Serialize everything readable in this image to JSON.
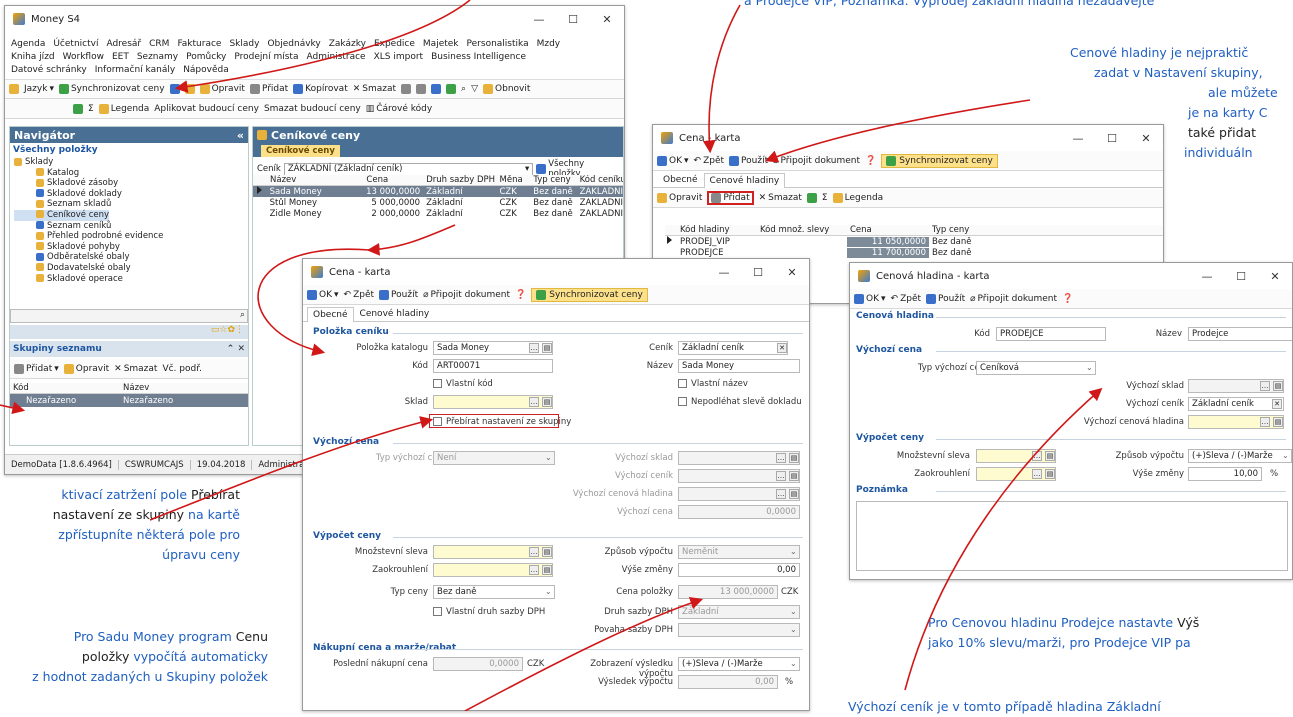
{
  "win1": {
    "title": "Money S4",
    "menu_row1": [
      "Agenda",
      "Účetnictví",
      "Adresář",
      "CRM",
      "Fakturace",
      "Sklady",
      "Objednávky",
      "Zakázky",
      "Expedice",
      "Majetek",
      "Personalistika",
      "Mzdy"
    ],
    "menu_row2": [
      "Kniha jízd",
      "Workflow",
      "EET",
      "Seznamy",
      "Pomůcky",
      "Prodejní místa",
      "Administrace",
      "XLS import",
      "Business Intelligence"
    ],
    "menu_row3": [
      "Datové schránky",
      "Informační kanály",
      "Nápověda"
    ],
    "toolbar1": [
      "Jazyk",
      "Synchronizovat ceny",
      "Opravit",
      "Přidat",
      "Kopírovat",
      "Smazat",
      "Obnovit"
    ],
    "toolbar2": [
      "Legenda",
      "Aplikovat budoucí ceny",
      "Smazat budoucí ceny",
      "Čárové kódy"
    ],
    "nav_title": "Navigátor",
    "nav_sub": "Všechny položky",
    "tree": [
      "Sklady",
      "Katalog",
      "Skladové zásoby",
      "Skladové doklady",
      "Seznam skladů",
      "Ceníkové ceny",
      "Seznam ceníků",
      "Přehled podrobné evidence",
      "Skladové pohyby",
      "Odběratelské obaly",
      "Dodavatelské obaly",
      "Skladové operace"
    ],
    "groups_title": "Skupiny seznamu",
    "groups_tb": [
      "Přidat",
      "Opravit",
      "Smazat",
      "Vč. podř."
    ],
    "groups_cols": [
      "Kód",
      "Název"
    ],
    "groups_row": [
      "Nezařazeno",
      "Nezařazeno"
    ],
    "main_title": "Ceníkové ceny",
    "main_tab": "Ceníkové ceny",
    "filter_label": "Ceník",
    "filter_value": "ZÁKLADNÍ (Základní ceník)",
    "all_items": "Všechny položky",
    "cols": [
      "Název",
      "Cena",
      "Druh sazby DPH",
      "Měna",
      "Typ ceny",
      "Kód ceníku"
    ],
    "rows": [
      [
        "Sada Money",
        "13 000,0000",
        "Základní",
        "CZK",
        "Bez daně",
        "ZÁKLADNÍ"
      ],
      [
        "Stůl Money",
        "5 000,0000",
        "Základní",
        "CZK",
        "Bez daně",
        "ZÁKLADNÍ"
      ],
      [
        "Židle Money",
        "2 000,0000",
        "Základní",
        "CZK",
        "Bez daně",
        "ZÁKLADNÍ"
      ]
    ],
    "status": [
      "DemoData [1.8.6.4964]",
      "CSWRUMCAJS",
      "19.04.2018",
      "Administrát"
    ]
  },
  "win2": {
    "title": "Cena - karta",
    "toolbar": [
      "OK",
      "Zpět",
      "Použít",
      "Připojit dokument",
      "Synchronizovat ceny"
    ],
    "tabs": [
      "Obecné",
      "Cenové hladiny"
    ],
    "sub_toolbar": [
      "Opravit",
      "Přidat",
      "Smazat",
      "Legenda"
    ],
    "cols": [
      "Kód hladiny",
      "Kód množ. slevy",
      "Cena",
      "Typ ceny"
    ],
    "rows": [
      [
        "PRODEJ_VIP",
        "",
        "11 050,0000",
        "Bez daně"
      ],
      [
        "PRODEJCE",
        "",
        "11 700,0000",
        "Bez daně"
      ]
    ]
  },
  "win3": {
    "title": "Cena - karta",
    "toolbar": [
      "OK",
      "Zpět",
      "Použít",
      "Připojit dokument",
      "Synchronizovat ceny"
    ],
    "tabs": [
      "Obecné",
      "Cenové hladiny"
    ],
    "sec1": "Položka ceníku",
    "l_polozka": "Položka katalogu",
    "v_polozka": "Sada Money",
    "l_kod": "Kód",
    "v_kod": "ART00071",
    "l_vlkod": "Vlastní kód",
    "l_sklad": "Sklad",
    "l_prebirat": "Přebírat nastavení ze skupiny",
    "l_cenik": "Ceník",
    "v_cenik": "Základní ceník",
    "l_nazev": "Název",
    "v_nazev": "Sada Money",
    "l_vlnazev": "Vlastní název",
    "l_nepodl": "Nepodléhat slevě dokladu",
    "sec2": "Výchozí cena",
    "l_typvc": "Typ výchozí ceny",
    "v_typvc": "Není",
    "l_vsklad": "Výchozí sklad",
    "l_vcenik": "Výchozí ceník",
    "l_vhladina": "Výchozí cenová hladina",
    "l_vcena": "Výchozí cena",
    "v_vcena": "0,0000",
    "sec3": "Výpočet ceny",
    "l_mnsleva": "Množstevní sleva",
    "l_zaokr": "Zaokrouhlení",
    "l_zpusob": "Způsob výpočtu",
    "v_zpusob": "Neměnit",
    "l_vyse": "Výše změny",
    "v_vyse": "0,00",
    "l_typceny": "Typ ceny",
    "v_typceny": "Bez daně",
    "l_cenapol": "Cena položky",
    "v_cenapol": "13 000,0000",
    "v_mena": "CZK",
    "l_vldruh": "Vlastní druh sazby DPH",
    "l_druh": "Druh sazby DPH",
    "v_druh": "Základní",
    "l_povaha": "Povaha sazby DPH",
    "sec4": "Nákupní cena a marže/rabat",
    "l_posl": "Poslední nákupní cena",
    "v_posl": "0,0000",
    "v_posl_mena": "CZK",
    "l_zobraz": "Zobrazení výsledku výpočtu",
    "v_zobraz": "(+)Sleva / (-)Marže",
    "l_vysl": "Výsledek výpočtu",
    "v_vysl": "0,00",
    "v_pct": "%"
  },
  "win4": {
    "title": "Cenová hladina - karta",
    "toolbar": [
      "OK",
      "Zpět",
      "Použít",
      "Připojit dokument"
    ],
    "sec1": "Cenová hladina",
    "l_kod": "Kód",
    "v_kod": "PRODEJCE",
    "l_nazev": "Název",
    "v_nazev": "Prodejce",
    "sec2": "Výchozí cena",
    "l_typ": "Typ výchozí ceny",
    "v_typ": "Ceníková",
    "l_sklad": "Výchozí sklad",
    "l_cenik": "Výchozí ceník",
    "v_cenik": "Základní ceník",
    "l_hladina": "Výchozí cenová hladina",
    "sec3": "Výpočet ceny",
    "l_mnsleva": "Množstevní sleva",
    "l_zaokr": "Zaokrouhlení",
    "l_zpusob": "Způsob výpočtu",
    "v_zpusob": "(+)Sleva / (-)Marže",
    "l_vyse": "Výše změny",
    "v_vyse": "10,00",
    "v_pct": "%",
    "sec4": "Poznámka"
  },
  "notes": {
    "top": "a Prodejce VIP, Poznámka: Výprodej základní hladina nezadávejte",
    "right1": "Cenové hladiny je nejpraktič",
    "right2": "zadat v Nastavení skupiny,",
    "right3": "ale můžete",
    "right4": "je na karty C",
    "right5": "také přidat",
    "right6": "individuáln",
    "left1a": "ktivací zatržení pole ",
    "left1b": "Přebírat",
    "left2a": "nastavení ze skupiny",
    "left2b": " na kartě",
    "left3": "zpřístupníte některá pole pro",
    "left4": "úpravu ceny",
    "left5a": "Pro Sadu Money program ",
    "left5b": "Cenu",
    "left6a": "položky",
    "left6b": " vypočítá automaticky",
    "left7": "z hodnot zadaných u Skupiny položek",
    "br1a": "Pro Cenovou hladinu Prodejce nastavte ",
    "br1b": "Výš",
    "br2": "jako 10% slevu/marži, pro Prodejce VIP pa",
    "br3": "Výchozí ceník je v tomto případě hladina Základní"
  }
}
